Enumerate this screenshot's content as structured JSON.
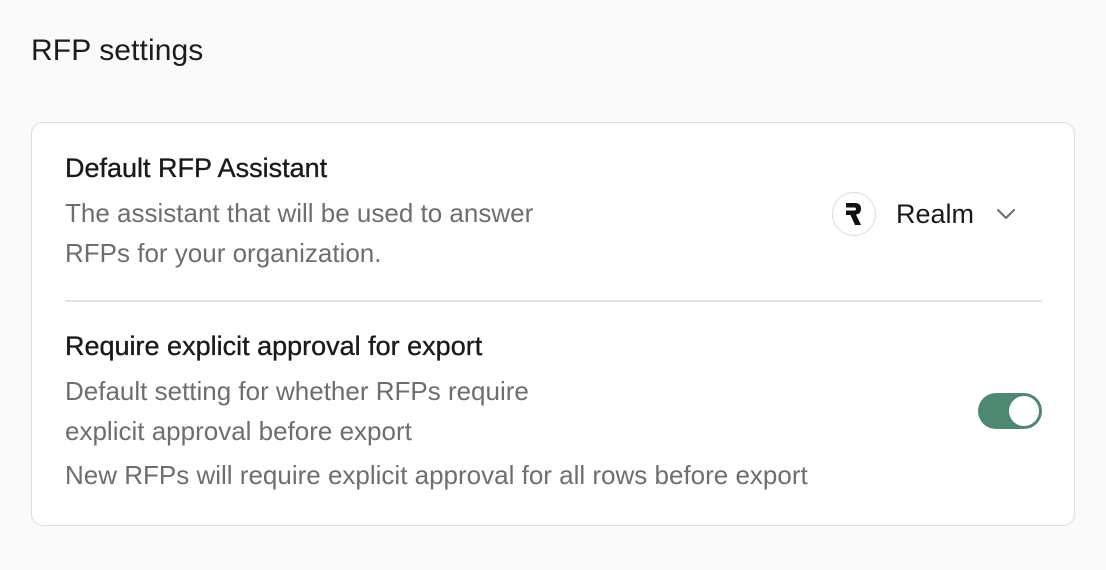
{
  "page": {
    "title": "RFP settings"
  },
  "settings": {
    "default_assistant": {
      "title": "Default RFP Assistant",
      "description": "The assistant that will be used to answer RFPs for your organization.",
      "selected_value": "Realm",
      "avatar_icon": "realm-logo-icon",
      "dropdown_icon": "chevron-down-icon"
    },
    "explicit_approval": {
      "title": "Require explicit approval for export",
      "description": "Default setting for whether RFPs require explicit approval before export",
      "note": "New RFPs will require explicit approval for all rows before export",
      "enabled": true,
      "toggle_color": "#4f8870"
    }
  }
}
